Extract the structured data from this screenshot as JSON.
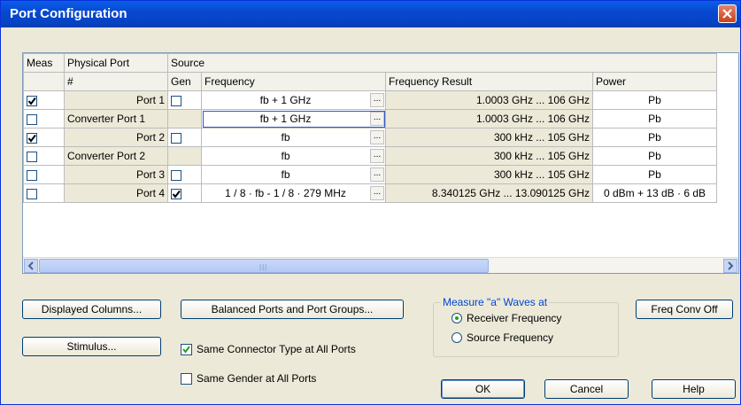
{
  "window": {
    "title": "Port Configuration"
  },
  "grid": {
    "group_headers": {
      "meas": "Meas",
      "physical_port": "Physical Port",
      "source": "Source"
    },
    "col_headers": {
      "num": "#",
      "gen": "Gen",
      "frequency": "Frequency",
      "frequency_result": "Frequency Result",
      "power": "Power"
    },
    "rows": [
      {
        "meas": true,
        "port": "Port 1",
        "port_align": "right",
        "gen": "unchecked",
        "frequency": "fb + 1 GHz",
        "result": "1.0003 GHz ... 106 GHz",
        "power": "Pb"
      },
      {
        "meas": false,
        "port": "Converter Port 1",
        "port_align": "left",
        "gen": "none",
        "frequency": "fb + 1 GHz",
        "result": "1.0003 GHz ... 106 GHz",
        "power": "Pb"
      },
      {
        "meas": true,
        "port": "Port 2",
        "port_align": "right",
        "gen": "unchecked",
        "frequency": "fb",
        "result": "300 kHz ... 105 GHz",
        "power": "Pb"
      },
      {
        "meas": false,
        "port": "Converter Port 2",
        "port_align": "left",
        "gen": "none",
        "frequency": "fb",
        "result": "300 kHz ... 105 GHz",
        "power": "Pb"
      },
      {
        "meas": false,
        "port": "Port 3",
        "port_align": "right",
        "gen": "unchecked",
        "frequency": "fb",
        "result": "300 kHz ... 105 GHz",
        "power": "Pb"
      },
      {
        "meas": false,
        "port": "Port 4",
        "port_align": "right",
        "gen": "checked",
        "frequency": "1 / 8 · fb - 1 / 8 · 279 MHz",
        "result": "8.340125 GHz ... 13.090125 GHz",
        "power": "0 dBm + 13 dB  · 6 dB"
      }
    ],
    "ellipsis": "...",
    "scroll_grip": "|||"
  },
  "buttons": {
    "displayed_columns": "Displayed Columns...",
    "balanced_ports": "Balanced Ports and Port Groups...",
    "freq_conv_off": "Freq Conv Off",
    "stimulus": "Stimulus...",
    "ok": "OK",
    "cancel": "Cancel",
    "help": "Help"
  },
  "options": {
    "same_connector": {
      "label": "Same Connector Type at All Ports",
      "checked": true
    },
    "same_gender": {
      "label": "Same Gender at All Ports",
      "checked": false
    }
  },
  "measure_group": {
    "legend": "Measure \"a\" Waves at",
    "receiver": "Receiver Frequency",
    "source": "Source Frequency",
    "selected": "receiver"
  }
}
